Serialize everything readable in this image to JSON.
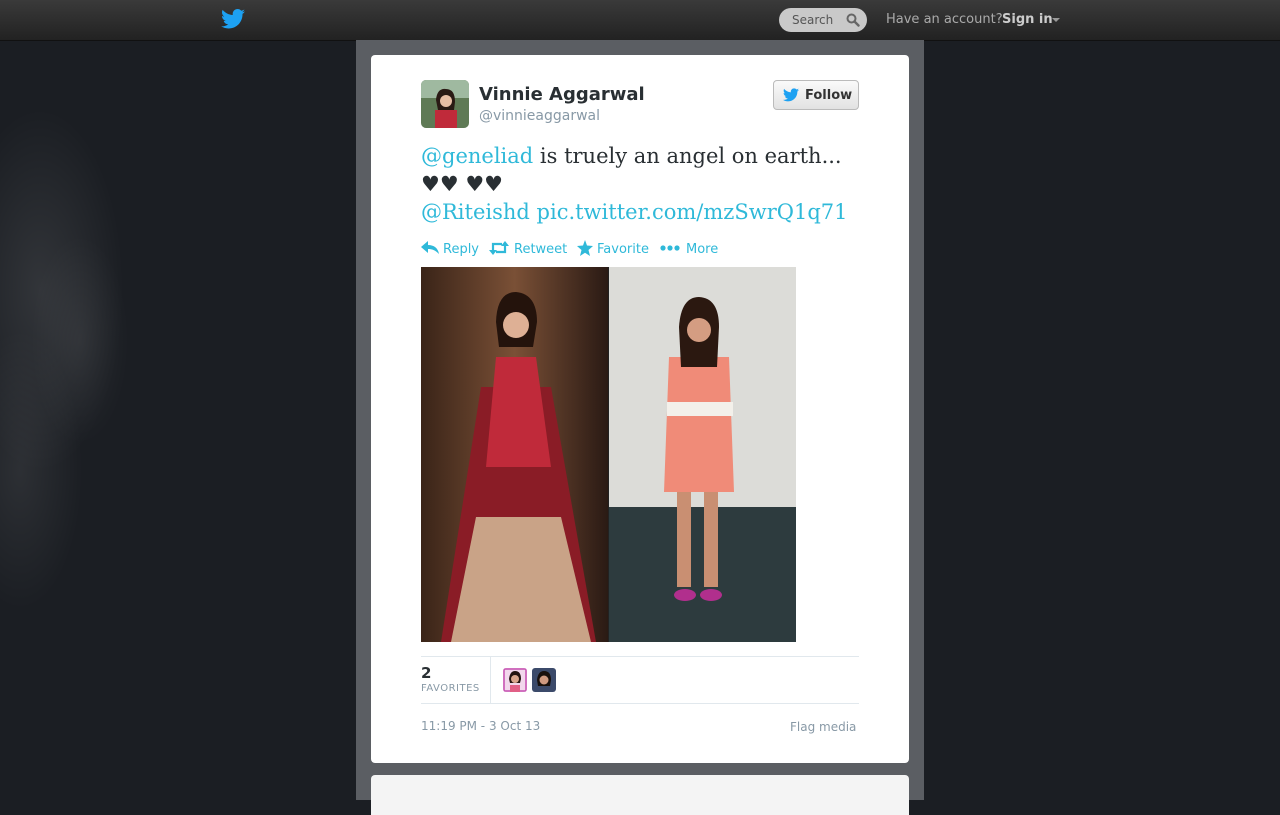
{
  "topbar": {
    "logo_icon": "twitter-bird-icon",
    "search_placeholder": "Search",
    "have_account": "Have an account?",
    "sign_in": "Sign in"
  },
  "tweet": {
    "author": {
      "name": "Vinnie Aggarwal",
      "handle": "@vinnieaggarwal"
    },
    "follow_label": "Follow",
    "text": {
      "mention1": "@geneliad",
      "body": " is truely an angel on earth... ♥♥ ♥♥",
      "mention2": "@Riteishd",
      "pic_link": "pic.twitter.com/mzSwrQ1q71"
    },
    "actions": {
      "reply": "Reply",
      "retweet": "Retweet",
      "favorite": "Favorite",
      "more": "More"
    },
    "stats": {
      "favorites_count": "2",
      "favorites_label": "FAVORITES"
    },
    "timestamp": "11:19 PM - 3 Oct 13",
    "flag_media": "Flag media"
  },
  "colors": {
    "link": "#2fb9d9",
    "twitter_blue": "#1da1f2",
    "background": "#1b1e23"
  }
}
